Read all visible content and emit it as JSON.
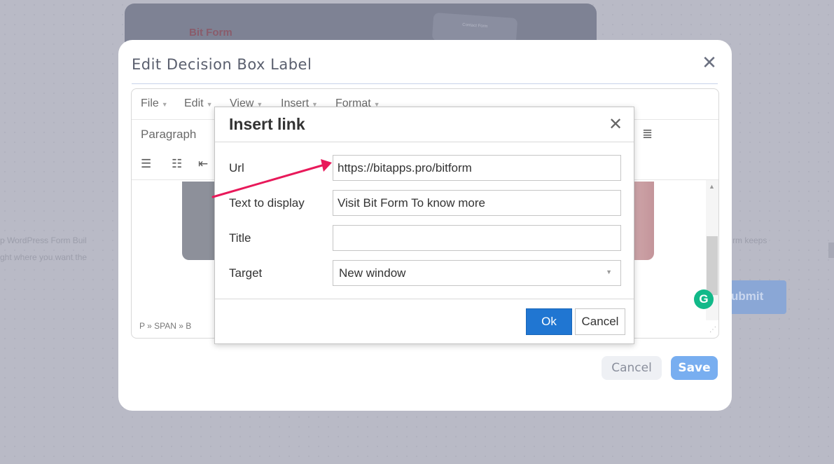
{
  "background": {
    "brand_part1": "Bit",
    "brand_part2": "Form",
    "card_text": "Contact Form",
    "left_text_line1": "p WordPress Form Buil",
    "left_text_line2": "ght where you want the",
    "right_text": "rm keeps",
    "submit_label": "ubmit"
  },
  "modal": {
    "title": "Edit Decision Box Label",
    "close_icon": "close-icon",
    "cancel_label": "Cancel",
    "save_label": "Save",
    "save_color": "#78aef0"
  },
  "editor": {
    "menu": [
      "File",
      "Edit",
      "View",
      "Insert",
      "Format"
    ],
    "block_format": "Paragraph",
    "statusbar_path": "P » SPAN » B",
    "icons": [
      "ordered-list-icon",
      "bullet-list-icon",
      "outdent-icon",
      "align-justify-icon",
      "grammarly-icon"
    ]
  },
  "insert_link": {
    "title": "Insert link",
    "fields": {
      "url_label": "Url",
      "url_value": "https://bitapps.pro/bitform",
      "text_label": "Text to display",
      "text_value": "Visit Bit Form To know more",
      "title_label": "Title",
      "title_value": "",
      "target_label": "Target",
      "target_value": "New window"
    },
    "ok_label": "Ok",
    "cancel_label": "Cancel",
    "ok_color": "#2076d2"
  },
  "annotation": {
    "arrow_color": "#e8195a"
  }
}
